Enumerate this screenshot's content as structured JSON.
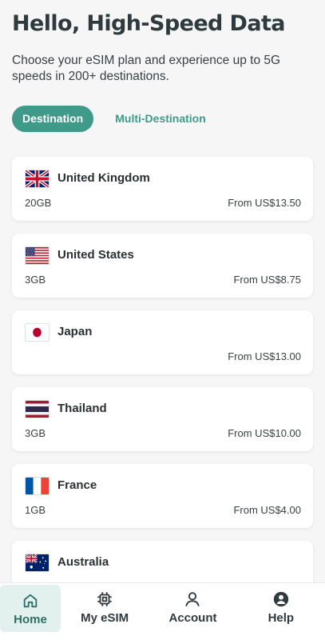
{
  "header": {
    "title": "Hello, High-Speed Data",
    "subtitle": "Choose your eSIM plan and experience up to 5G speeds in 200+ destinations."
  },
  "tabs": [
    {
      "label": "Destination",
      "active": true
    },
    {
      "label": "Multi-Destination",
      "active": false
    }
  ],
  "destinations": [
    {
      "flag": "uk-flag",
      "country": "United Kingdom",
      "data": "20GB",
      "price": "From US$13.50"
    },
    {
      "flag": "us-flag",
      "country": "United States",
      "data": "3GB",
      "price": "From US$8.75"
    },
    {
      "flag": "japan-flag",
      "country": "Japan",
      "data": "",
      "price": "From US$13.00"
    },
    {
      "flag": "thailand-flag",
      "country": "Thailand",
      "data": "3GB",
      "price": "From US$10.00"
    },
    {
      "flag": "france-flag",
      "country": "France",
      "data": "1GB",
      "price": "From US$4.00"
    },
    {
      "flag": "australia-flag",
      "country": "Australia",
      "data": "",
      "price": ""
    }
  ],
  "nav": [
    {
      "label": "Home",
      "icon": "home-icon",
      "active": true
    },
    {
      "label": "My eSIM",
      "icon": "chip-icon",
      "active": false
    },
    {
      "label": "Account",
      "icon": "user-icon",
      "active": false
    },
    {
      "label": "Help",
      "icon": "help-icon",
      "active": false
    }
  ],
  "colors": {
    "accent": "#3f9a8a",
    "nav_active_bg": "#e3f1ee"
  }
}
